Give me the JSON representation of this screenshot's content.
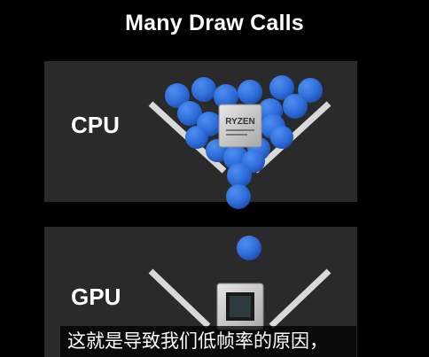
{
  "title": "Many Draw Calls",
  "cpu_panel": {
    "label": "CPU",
    "chip_brand": "RYZEN",
    "chip_icon": "cpu-chip-icon"
  },
  "gpu_panel": {
    "label": "GPU",
    "chip_icon": "gpu-chip-icon"
  },
  "subtitle": "这就是导致我们低帧率的原因，",
  "colors": {
    "background": "#000000",
    "panel": "#2a2a2a",
    "ball": "#2f6fdc",
    "funnel": "#d9d9d9",
    "text": "#ffffff"
  }
}
